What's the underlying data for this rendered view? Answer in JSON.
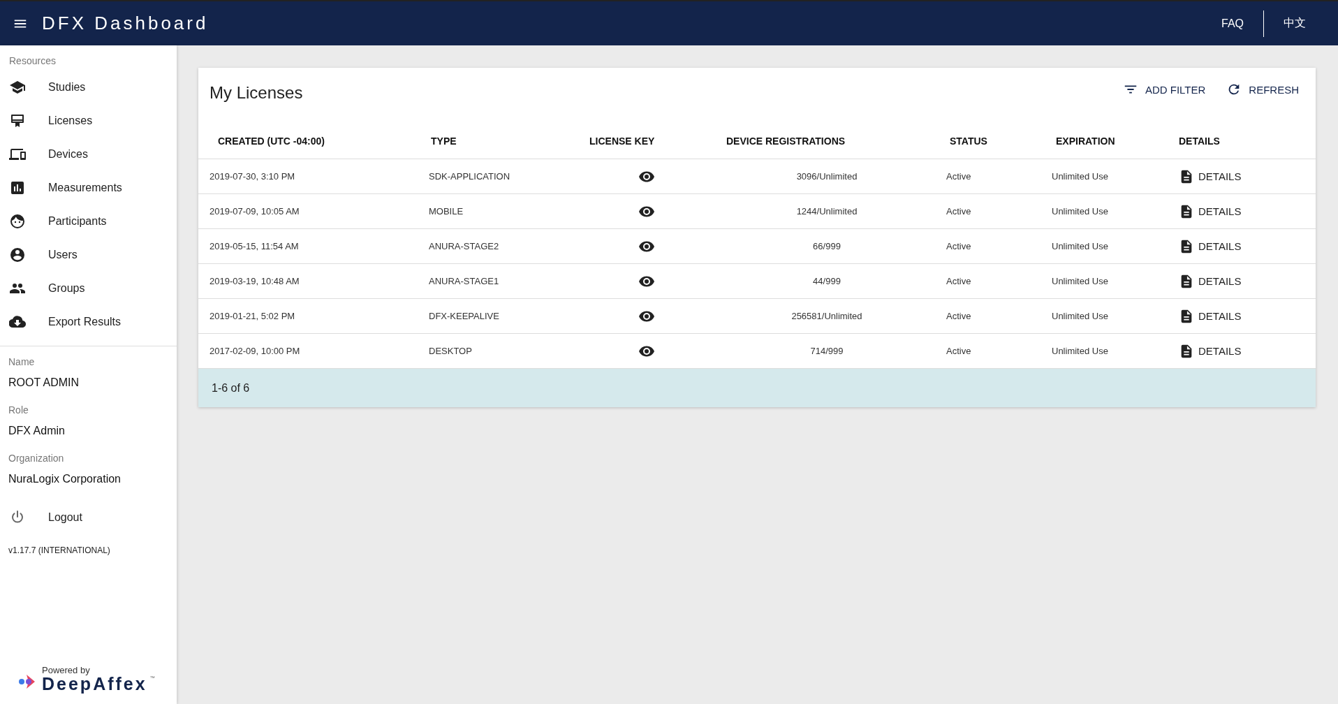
{
  "header": {
    "title": "DFX Dashboard",
    "links": [
      "FAQ",
      "中文"
    ]
  },
  "sidebar": {
    "section_label": "Resources",
    "items": [
      {
        "label": "Studies"
      },
      {
        "label": "Licenses"
      },
      {
        "label": "Devices"
      },
      {
        "label": "Measurements"
      },
      {
        "label": "Participants"
      },
      {
        "label": "Users"
      },
      {
        "label": "Groups"
      },
      {
        "label": "Export Results"
      }
    ],
    "profile": [
      {
        "label": "Name",
        "value": "ROOT ADMIN"
      },
      {
        "label": "Role",
        "value": "DFX Admin"
      },
      {
        "label": "Organization",
        "value": "NuraLogix Corporation"
      }
    ],
    "logout": "Logout",
    "version": "v1.17.7 (INTERNATIONAL)",
    "branding": {
      "powered_by": "Powered by",
      "name": "DeepAffex",
      "tm": "™"
    }
  },
  "card": {
    "title": "My Licenses",
    "actions": [
      "ADD FILTER",
      "REFRESH"
    ],
    "table": {
      "columns": [
        "CREATED (UTC -04:00)",
        "TYPE",
        "LICENSE KEY",
        "DEVICE REGISTRATIONS",
        "STATUS",
        "EXPIRATION",
        "DETAILS"
      ],
      "rows": [
        {
          "created": "2019-07-30, 3:10 PM",
          "type": "SDK-APPLICATION",
          "registrations": "3096/Unlimited",
          "status": "Active",
          "expiration": "Unlimited Use",
          "details": "DETAILS"
        },
        {
          "created": "2019-07-09, 10:05 AM",
          "type": "MOBILE",
          "registrations": "1244/Unlimited",
          "status": "Active",
          "expiration": "Unlimited Use",
          "details": "DETAILS"
        },
        {
          "created": "2019-05-15, 11:54 AM",
          "type": "ANURA-STAGE2",
          "registrations": "66/999",
          "status": "Active",
          "expiration": "Unlimited Use",
          "details": "DETAILS"
        },
        {
          "created": "2019-03-19, 10:48 AM",
          "type": "ANURA-STAGE1",
          "registrations": "44/999",
          "status": "Active",
          "expiration": "Unlimited Use",
          "details": "DETAILS"
        },
        {
          "created": "2019-01-21, 5:02 PM",
          "type": "DFX-KEEPALIVE",
          "registrations": "256581/Unlimited",
          "status": "Active",
          "expiration": "Unlimited Use",
          "details": "DETAILS"
        },
        {
          "created": "2017-02-09, 10:00 PM",
          "type": "DESKTOP",
          "registrations": "714/999",
          "status": "Active",
          "expiration": "Unlimited Use",
          "details": "DETAILS"
        }
      ]
    },
    "pagination": "1-6 of 6"
  }
}
